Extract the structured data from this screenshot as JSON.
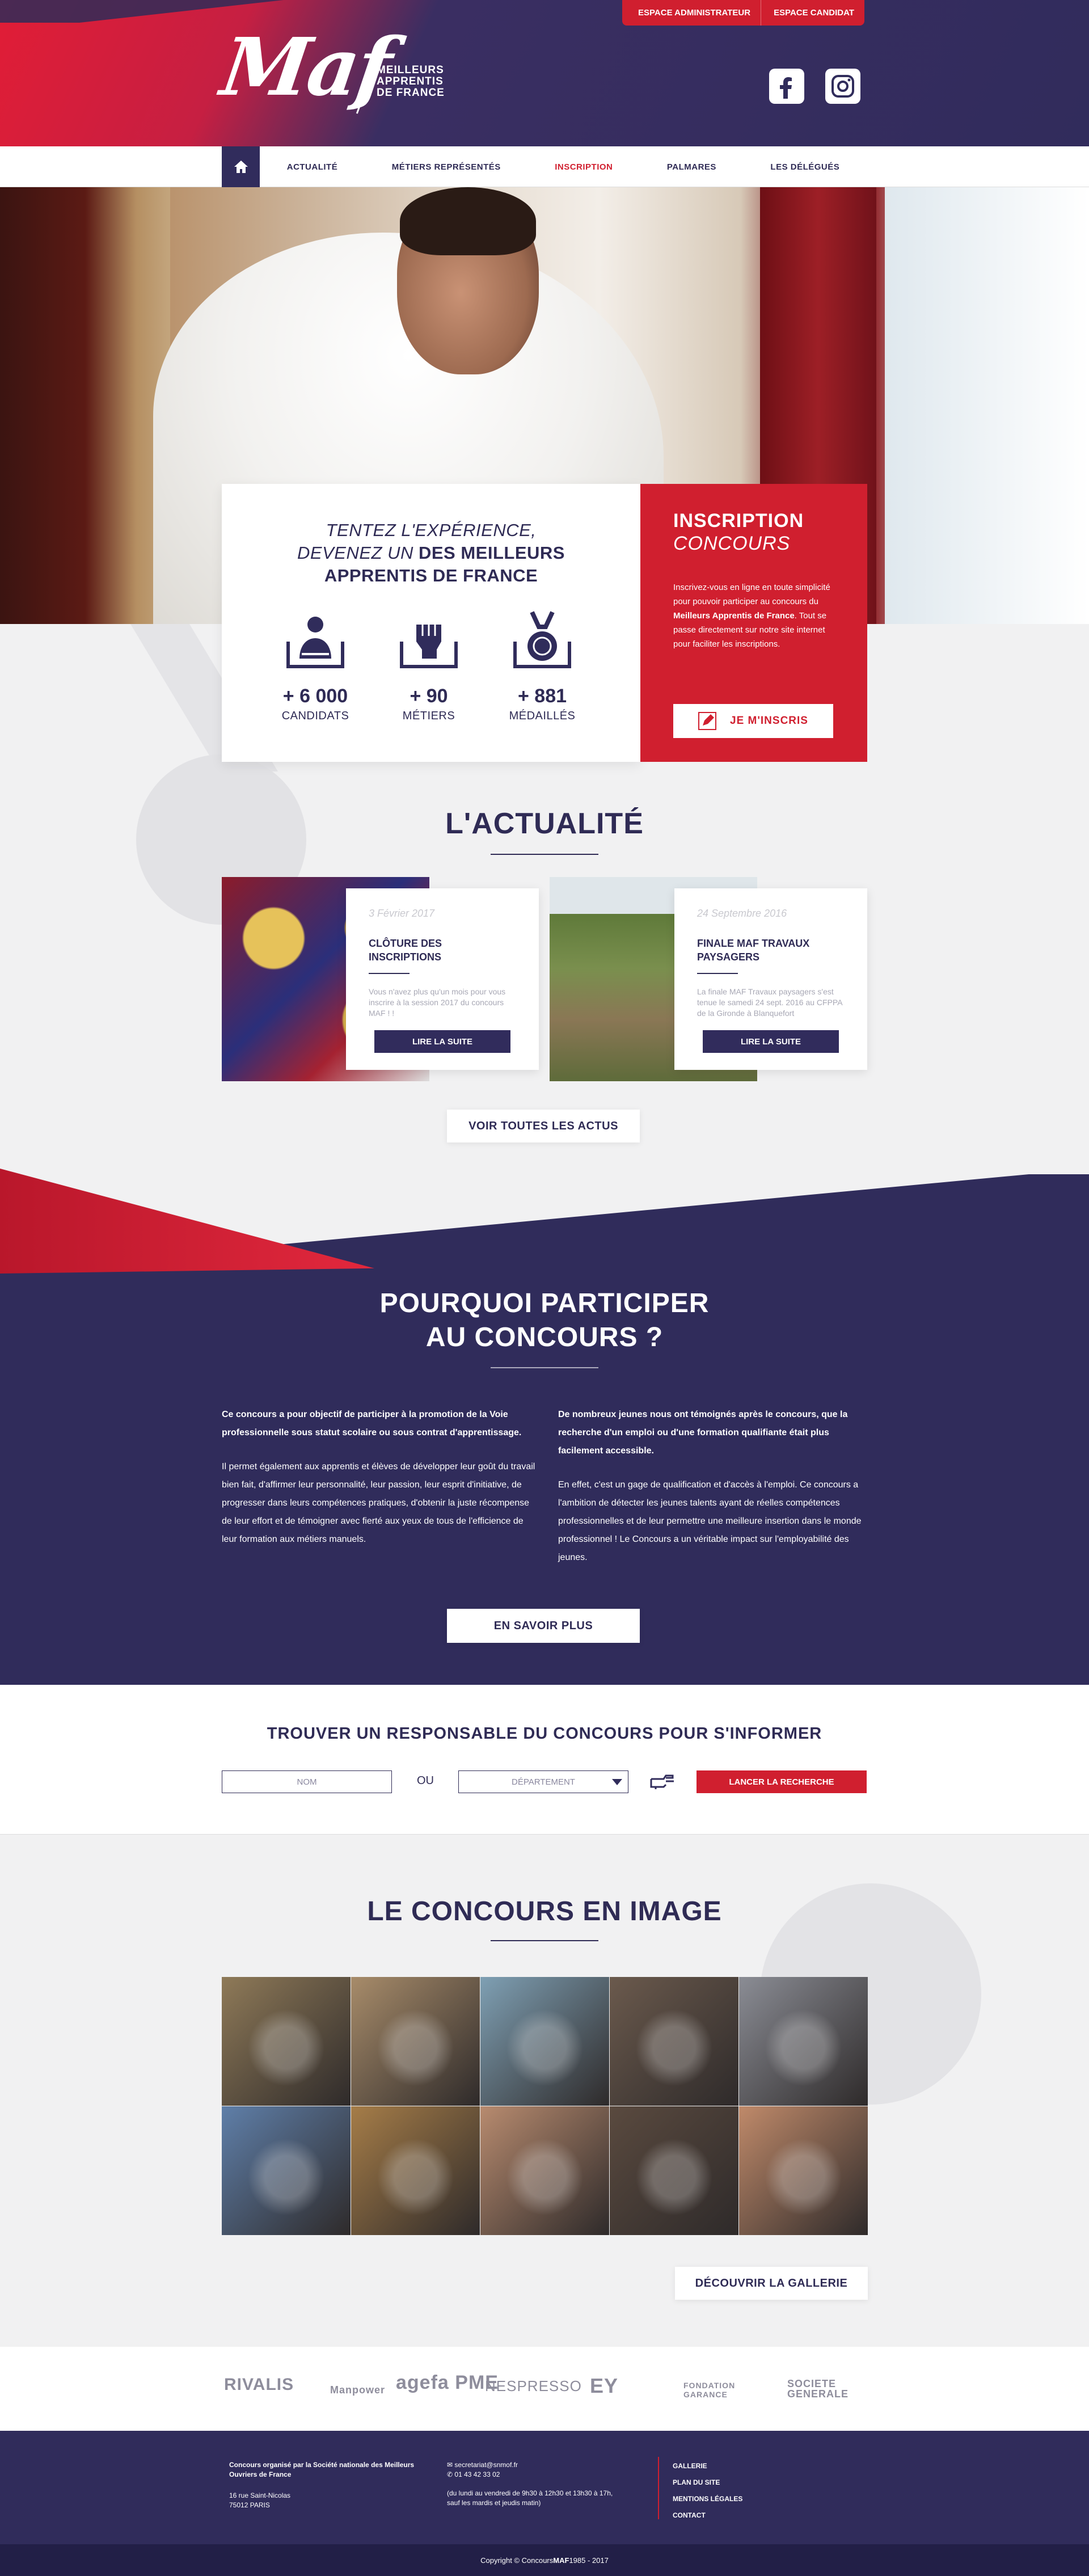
{
  "header": {
    "logo_word": "Maf",
    "logo_line1": "Meilleurs",
    "logo_line2": "Apprentis",
    "logo_line3": "de France",
    "btn_admin": "Espace administrateur",
    "btn_candidat": "Espace candidat",
    "social": [
      "facebook-icon",
      "instagram-icon"
    ]
  },
  "nav": {
    "items": [
      {
        "label": "Actualité"
      },
      {
        "label": "Métiers représentés"
      },
      {
        "label": "Inscription",
        "active": true
      },
      {
        "label": "Palmares"
      },
      {
        "label": "Les délégués"
      }
    ]
  },
  "hero": {
    "tagline_1": "Tentez l'expérience,",
    "tagline_2a": "devenez un",
    "tagline_2b": "des Meilleurs",
    "tagline_3": "Apprentis de France",
    "stats": [
      {
        "value": "+ 6 000",
        "label": "Candidats",
        "icon": "candidate-icon"
      },
      {
        "value": "+ 90",
        "label": "Métiers",
        "icon": "fist-icon"
      },
      {
        "value": "+ 881",
        "label": "Médaillés",
        "icon": "medal-icon"
      }
    ],
    "ins_title": "Inscription",
    "ins_subtitle": "Concours",
    "ins_text_1": "Inscrivez-vous en ligne en toute simplicité pour pouvoir participer au concours du ",
    "ins_text_bold": "Meilleurs Apprentis de France",
    "ins_text_2": ". Tout se passe directement sur notre site internet pour faciliter les inscriptions.",
    "ins_button": "Je m'inscris"
  },
  "news": {
    "title": "L'actualité",
    "items": [
      {
        "date": "3 Février 2017",
        "title": "Clôture des inscriptions",
        "excerpt": "Vous n'avez plus qu'un mois pour vous inscrire à la session 2017 du concours MAF ! !",
        "button": "Lire la suite"
      },
      {
        "date": "24 Septembre 2016",
        "title": "Finale MAF Travaux paysagers",
        "excerpt": "La finale MAF Travaux paysagers s'est tenue le samedi 24 sept. 2016 au CFPPA de la Gironde à Blanquefort",
        "button": "Lire la suite"
      }
    ],
    "all_button": "Voir toutes les actus"
  },
  "why": {
    "title_1": "Pourquoi participer",
    "title_2": "au concours ?",
    "left_bold": "Ce concours a pour objectif de participer à la promotion de la Voie professionnelle sous statut scolaire ou sous contrat d'apprentissage.",
    "left_text": "Il permet également aux apprentis et élèves de développer leur goût du travail bien fait, d'affirmer leur personnalité, leur passion, leur esprit d'initiative, de progresser dans leurs compétences pratiques, d'obtenir la juste récompense de leur effort et de témoigner avec fierté aux yeux de tous de l'efficience de leur formation aux métiers manuels.",
    "right_bold": "De nombreux jeunes nous ont témoignés après le concours, que la recherche d'un emploi ou d'une formation qualifiante était plus facilement accessible.",
    "right_text": "En effet, c'est un gage de qualification et d'accès à l'emploi. Ce concours a l'ambition de détecter les jeunes talents ayant de réelles compétences professionnelles et de leur permettre une meilleure insertion dans le monde professionnel ! Le Concours a un véritable impact sur l'employabilité des jeunes.",
    "button": "En savoir plus"
  },
  "responsable": {
    "title": "Trouver un responsable du concours pour s'informer",
    "name_placeholder": "Nom",
    "or": "ou",
    "dept_placeholder": "Département",
    "button": "Lancer la recherche"
  },
  "gallery": {
    "title": "Le concours en image",
    "button": "Découvrir la gallerie",
    "cells": [
      "#8f7a58",
      "#a88c6a",
      "#7fa0b4",
      "#6b5a4d",
      "#8b8d95",
      "#5f7fa9",
      "#a67d48",
      "#b88b6f",
      "#5a4a3f",
      "#c08a6a"
    ]
  },
  "partners": [
    "RIVALIS",
    "Manpower",
    "agefa PME",
    "NESPRESSO",
    "EY",
    "FONDATION GARANCE",
    "SOCIETE GENERALE"
  ],
  "footer": {
    "org_1": "Concours organisé par la Société nationale des Meilleurs",
    "org_2": "Ouvriers de France",
    "addr_1": "16 rue Saint-Nicolas",
    "addr_2": "75012 PARIS",
    "email": "secretariat@snmof.fr",
    "phone": "01 43 42 33 02",
    "hours_1": "(du lundi au vendredi de 9h30 à 12h30 et 13h30 à 17h,",
    "hours_2": "sauf les mardis et jeudis matin)",
    "links": [
      "Gallerie",
      "Plan du site",
      "Mentions légales",
      "Contact"
    ],
    "copyright_pre": "Copyright © Concours ",
    "copyright_bold": "MAF",
    "copyright_post": " 1985 - 2017"
  },
  "colors": {
    "brand_red": "#d01f2f",
    "brand_navy": "#302c5b",
    "bg_grey": "#f1f1f2"
  }
}
